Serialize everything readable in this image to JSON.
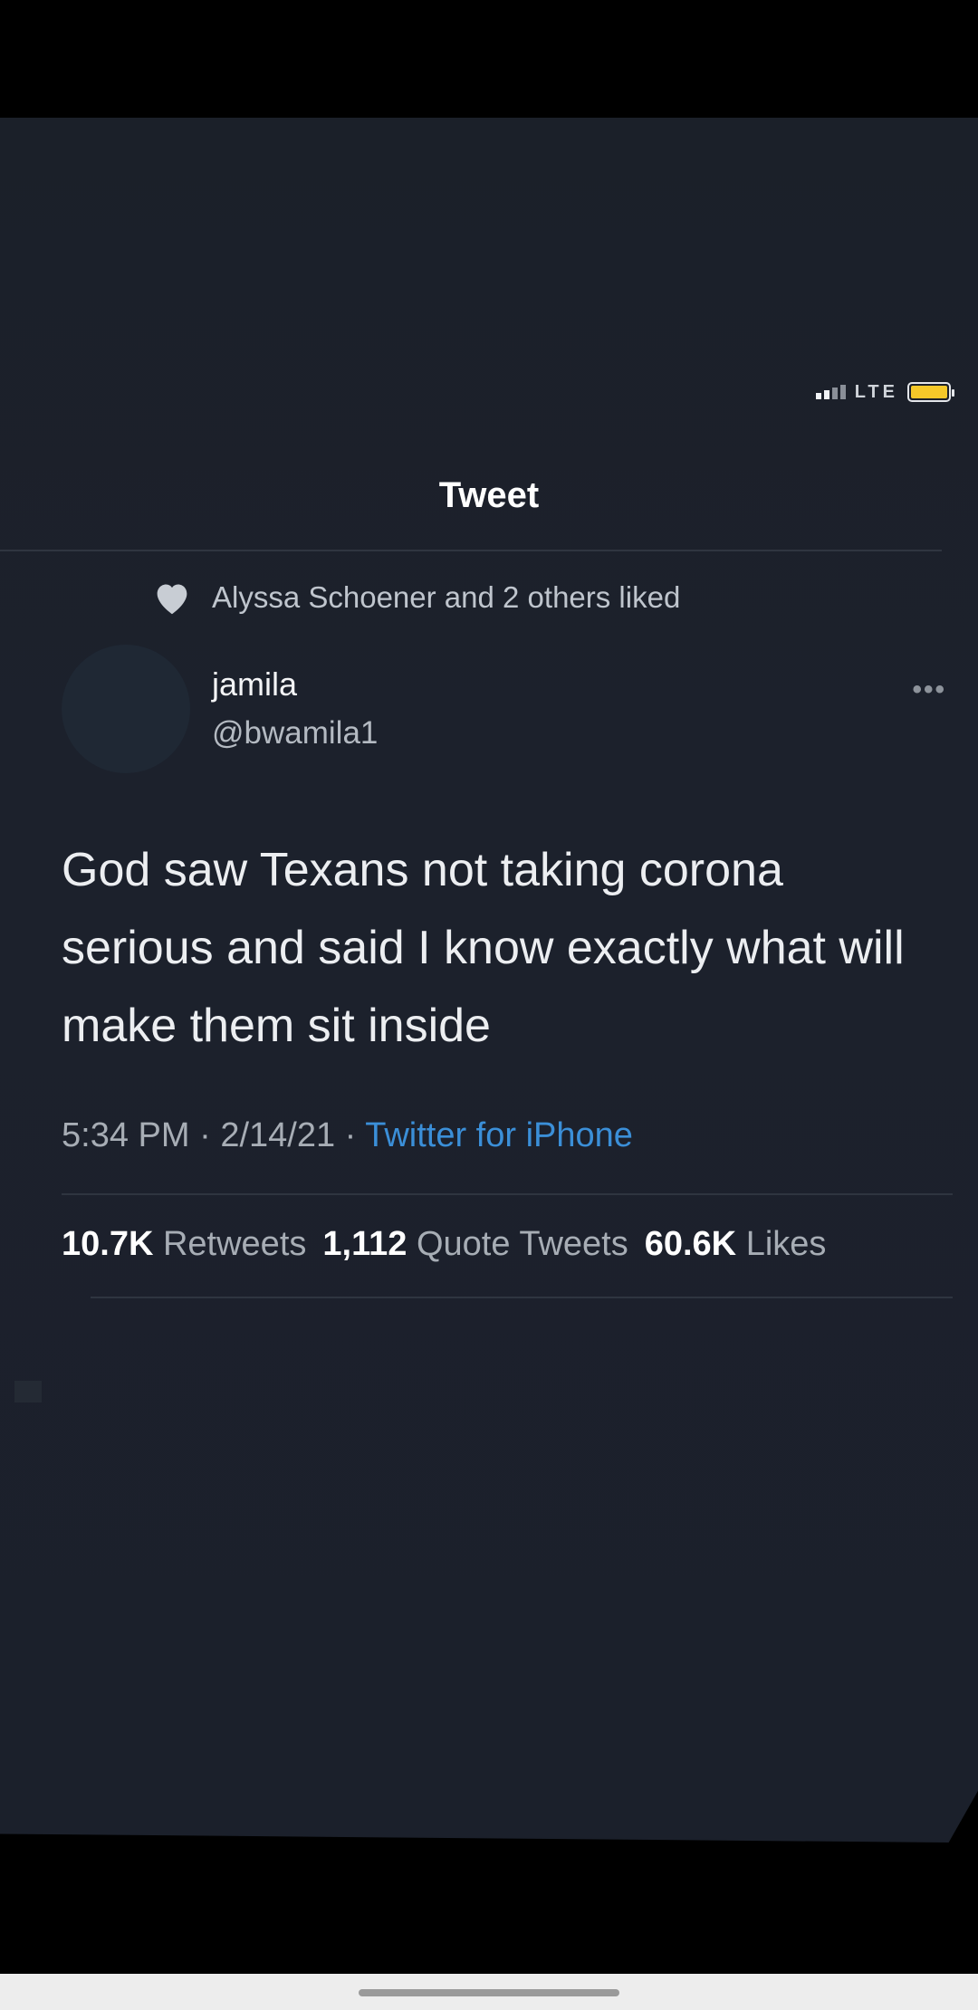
{
  "status_bar": {
    "carrier": "LTE",
    "signal_bars_on": 2,
    "signal_bars_total": 4,
    "battery_level": 1.0,
    "battery_color": "#f5c829"
  },
  "nav": {
    "title": "Tweet"
  },
  "social_context": {
    "text": "Alyssa Schoener and 2 others liked",
    "icon": "heart-icon"
  },
  "author": {
    "name": "jamila",
    "handle": "@bwamila1"
  },
  "tweet": {
    "text": "God saw Texans not taking corona serious and said I know exactly what will make them sit inside",
    "time": "5:34 PM",
    "date": "2/14/21",
    "separator": "·",
    "source": "Twitter for iPhone"
  },
  "stats": {
    "retweets_count": "10.7K",
    "retweets_label": "Retweets",
    "quotes_count": "1,112",
    "quotes_label": "Quote Tweets",
    "likes_count": "60.6K",
    "likes_label": "Likes"
  },
  "more_menu": {
    "icon": "more-icon",
    "label": "•••"
  },
  "colors": {
    "background": "#1b202b",
    "link": "#3b8fd8",
    "text_primary": "#ffffff",
    "text_secondary": "#a7adb5"
  }
}
